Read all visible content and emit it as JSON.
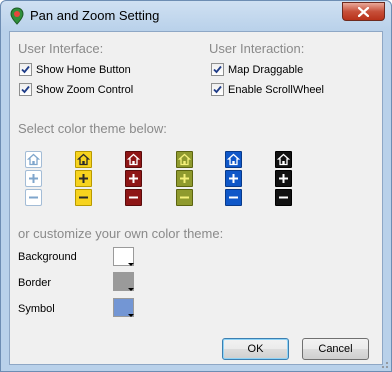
{
  "window": {
    "title": "Pan and Zoom Setting"
  },
  "user_interface": {
    "heading": "User Interface:",
    "items": [
      {
        "label": "Show Home Button",
        "checked": true
      },
      {
        "label": "Show Zoom Control",
        "checked": true
      }
    ]
  },
  "user_interaction": {
    "heading": "User Interaction:",
    "items": [
      {
        "label": "Map Draggable",
        "checked": true
      },
      {
        "label": "Enable ScrollWheel",
        "checked": true
      }
    ]
  },
  "themes": {
    "heading": "Select color theme below:",
    "options": [
      {
        "name": "light-blue-outline",
        "background": "#ffffff",
        "border": "#a3bcd6",
        "symbol": "#7fa6cc"
      },
      {
        "name": "yellow",
        "background": "#f7d31e",
        "border": "#b89a00",
        "symbol": "#2a2a2a"
      },
      {
        "name": "dark-red",
        "background": "#8e1616",
        "border": "#5a0b0b",
        "symbol": "#ffffff"
      },
      {
        "name": "olive",
        "background": "#8f9a2e",
        "border": "#5c6410",
        "symbol": "#f4f07a"
      },
      {
        "name": "blue",
        "background": "#0f57c8",
        "border": "#083a8a",
        "symbol": "#ffffff"
      },
      {
        "name": "black",
        "background": "#111111",
        "border": "#000000",
        "symbol": "#ffffff"
      }
    ]
  },
  "custom": {
    "heading": "or customize your own color theme:",
    "fields": [
      {
        "label": "Background",
        "color": "#ffffff"
      },
      {
        "label": "Border",
        "color": "#9a9a9a"
      },
      {
        "label": "Symbol",
        "color": "#7396d4"
      }
    ]
  },
  "buttons": {
    "ok": "OK",
    "cancel": "Cancel"
  }
}
